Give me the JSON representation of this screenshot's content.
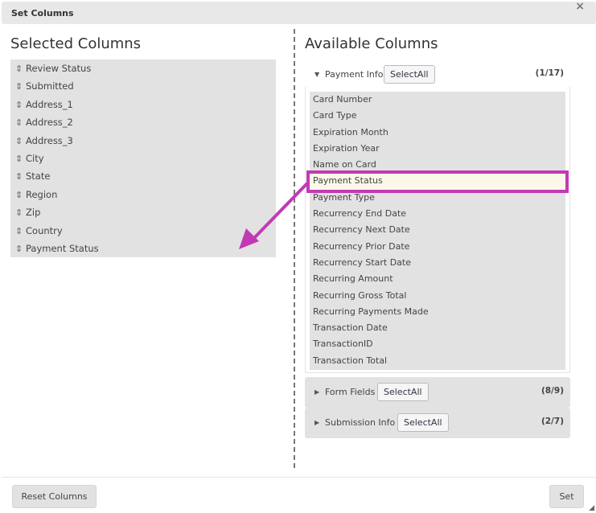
{
  "dialog": {
    "title": "Set Columns",
    "close_icon": "×"
  },
  "selected": {
    "heading": "Selected Columns",
    "drag_icon": "⇕",
    "items": [
      "Review Status",
      "Submitted",
      "Address_1",
      "Address_2",
      "Address_3",
      "City",
      "State",
      "Region",
      "Zip",
      "Country",
      "Payment Status"
    ]
  },
  "available": {
    "heading": "Available Columns",
    "groups": [
      {
        "label": "Payment Info",
        "expanded": true,
        "select_all": "SelectAll",
        "count": "(1/17)",
        "items": [
          "Card Number",
          "Card Type",
          "Expiration Month",
          "Expiration Year",
          "Name on Card",
          "Payment Status",
          "Payment Type",
          "Recurrency End Date",
          "Recurrency Next Date",
          "Recurrency Prior Date",
          "Recurrency Start Date",
          "Recurring Amount",
          "Recurring Gross Total",
          "Recurring Payments Made",
          "Transaction Date",
          "TransactionID",
          "Transaction Total"
        ],
        "highlighted": "Payment Status"
      },
      {
        "label": "Form Fields",
        "expanded": false,
        "select_all": "SelectAll",
        "count": "(8/9)"
      },
      {
        "label": "Submission Info",
        "expanded": false,
        "select_all": "SelectAll",
        "count": "(2/7)"
      }
    ]
  },
  "annotation": {
    "color": "#c23ab3"
  },
  "footer": {
    "reset_label": "Reset Columns",
    "set_label": "Set"
  },
  "icons": {
    "expanded": "▼",
    "collapsed": "▶",
    "resize": "◢"
  }
}
